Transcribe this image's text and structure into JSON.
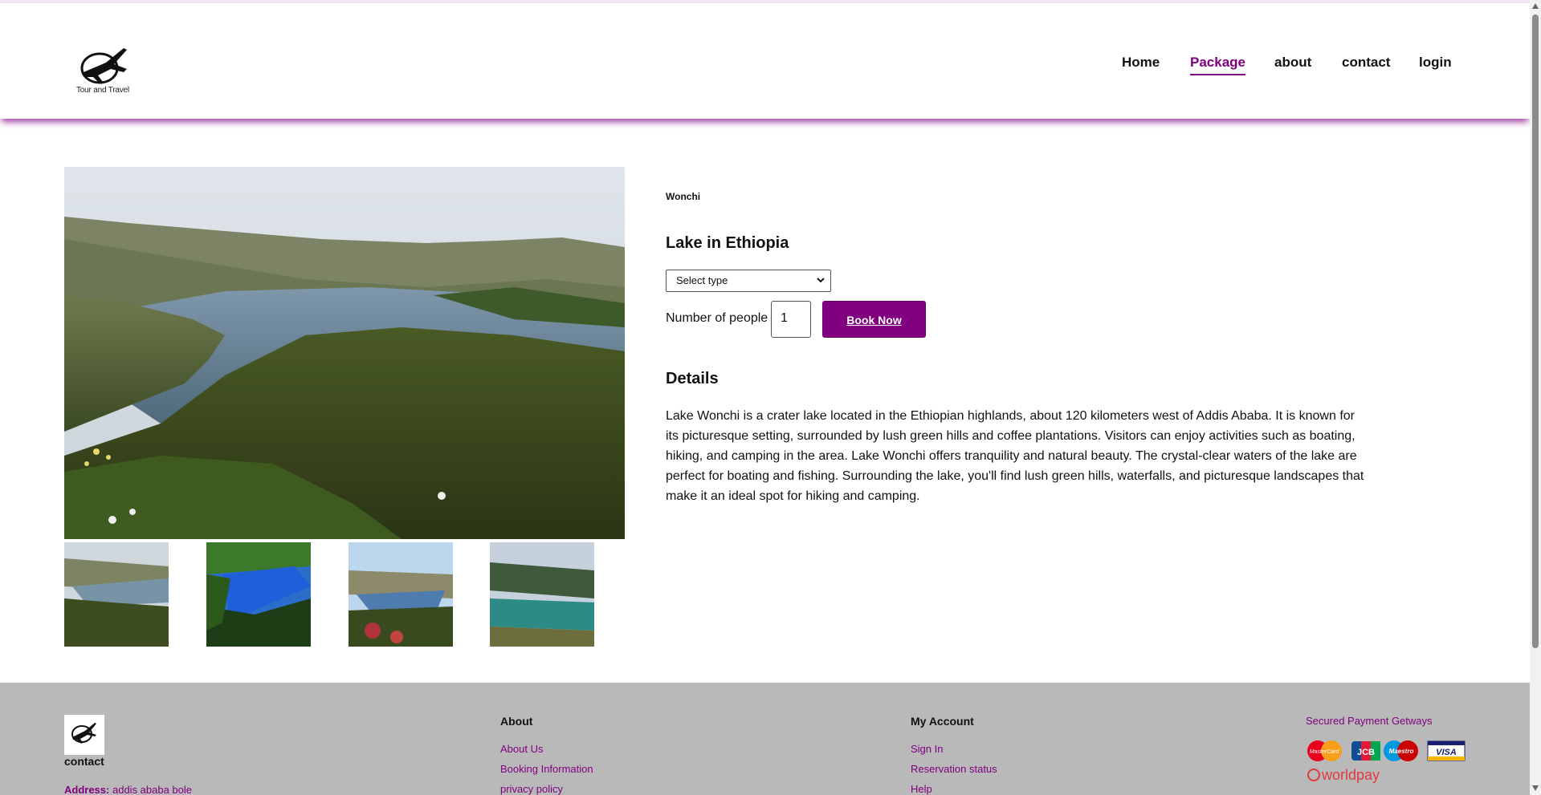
{
  "header": {
    "logo_text": "Tour and Travel",
    "nav": [
      {
        "label": "Home",
        "active": false
      },
      {
        "label": "Package",
        "active": true
      },
      {
        "label": "about",
        "active": false
      },
      {
        "label": "contact",
        "active": false
      },
      {
        "label": "login",
        "active": false
      }
    ]
  },
  "package": {
    "name": "Wonchi",
    "title": "Lake in Ethiopia",
    "type_select": {
      "selected": "Select type"
    },
    "people_label": "Number of people",
    "people_value": "1",
    "book_button": "Book Now",
    "details_heading": "Details",
    "details_text": "Lake Wonchi is a crater lake located in the Ethiopian highlands, about 120 kilometers west of Addis Ababa. It is known for its picturesque setting, surrounded by lush green hills and coffee plantations. Visitors can enjoy activities such as boating, hiking, and camping in the area. Lake Wonchi offers tranquility and natural beauty. The crystal-clear waters of the lake are perfect for boating and fishing. Surrounding the lake, you'll find lush green hills, waterfalls, and picturesque landscapes that make it an ideal spot for hiking and camping."
  },
  "footer": {
    "logo_text": "Tour and Travel",
    "contact_heading": "contact",
    "address_label": "Address:",
    "address_value": "addis ababa bole",
    "about_heading": "About",
    "about_links": [
      "About Us",
      "Booking Information",
      "privacy policy"
    ],
    "account_heading": "My Account",
    "account_links": [
      "Sign In",
      "Reservation status",
      "Help"
    ],
    "payment_heading": "Secured Payment Getways",
    "payment_cards": [
      "MasterCard",
      "JCB",
      "Maestro",
      "VISA"
    ],
    "payment_provider": "worldpay"
  },
  "colors": {
    "accent": "#800080",
    "footer_bg": "#b9b9b9"
  }
}
